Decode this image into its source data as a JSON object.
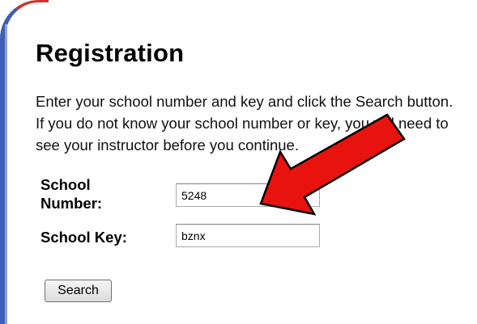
{
  "page": {
    "title": "Registration",
    "instructions": "Enter your school number and key and click the Search button. If you do not know your school number or key, you will need to see your instructor before you continue."
  },
  "form": {
    "school_number_label": "School Number:",
    "school_number_value": "5248",
    "school_key_label": "School Key:",
    "school_key_value": "bznx",
    "search_label": "Search"
  },
  "annotation": {
    "arrow_color": "#e8130f"
  },
  "colors": {
    "left_border": "#3d5fb4",
    "top_border": "#d0312d"
  }
}
